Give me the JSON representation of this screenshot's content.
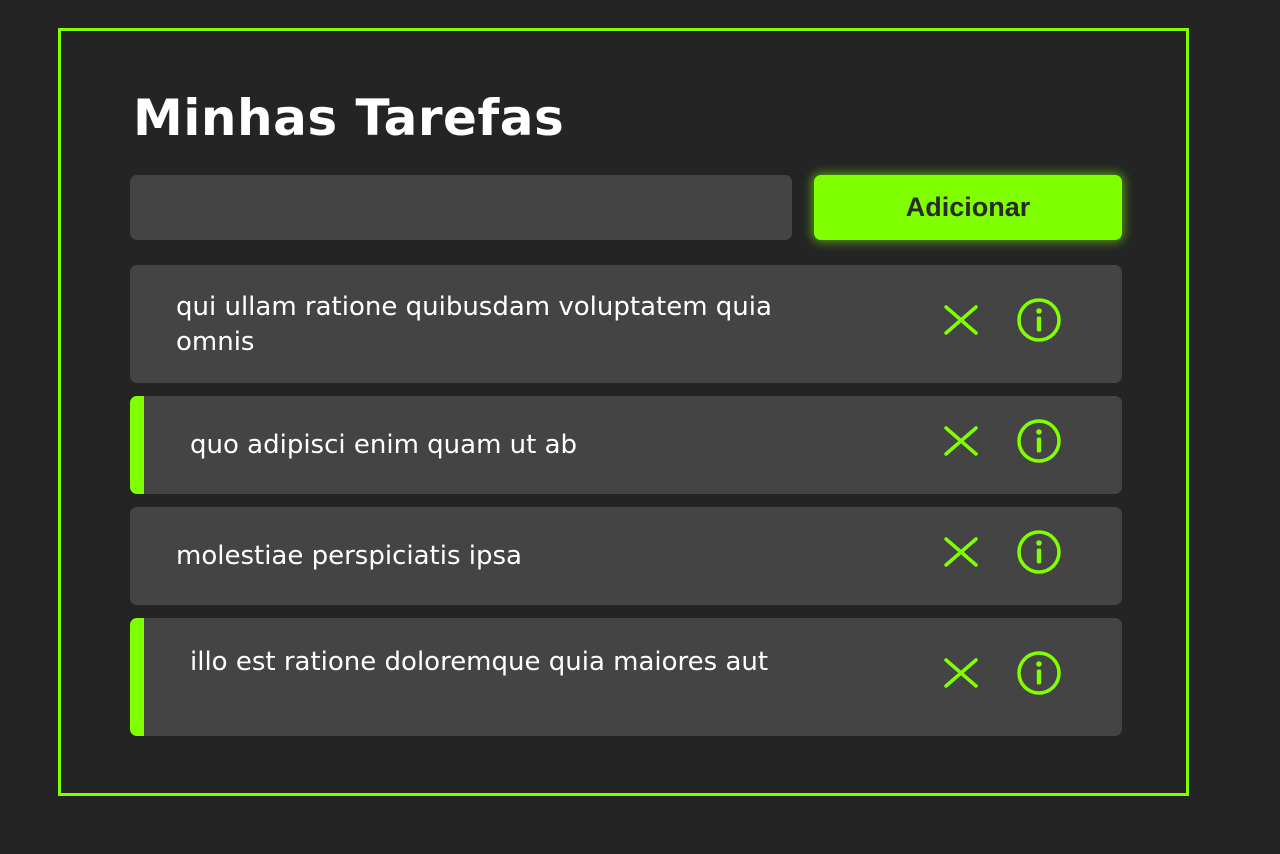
{
  "app": {
    "title": "Minhas Tarefas",
    "accent_color": "#80ff00",
    "background_color": "#242424",
    "panel_color": "#444444"
  },
  "form": {
    "input_value": "",
    "add_button_label": "Adicionar"
  },
  "tasks": [
    {
      "title": "qui ullam ratione quibusdam voluptatem quia omnis",
      "completed": false,
      "remove_icon": "close-icon",
      "info_icon": "info-icon"
    },
    {
      "title": "quo adipisci enim quam ut ab",
      "completed": true,
      "remove_icon": "close-icon",
      "info_icon": "info-icon"
    },
    {
      "title": "molestiae perspiciatis ipsa",
      "completed": false,
      "remove_icon": "close-icon",
      "info_icon": "info-icon"
    },
    {
      "title": "illo est ratione doloremque quia maiores aut",
      "completed": true,
      "remove_icon": "close-icon",
      "info_icon": "info-icon"
    }
  ]
}
